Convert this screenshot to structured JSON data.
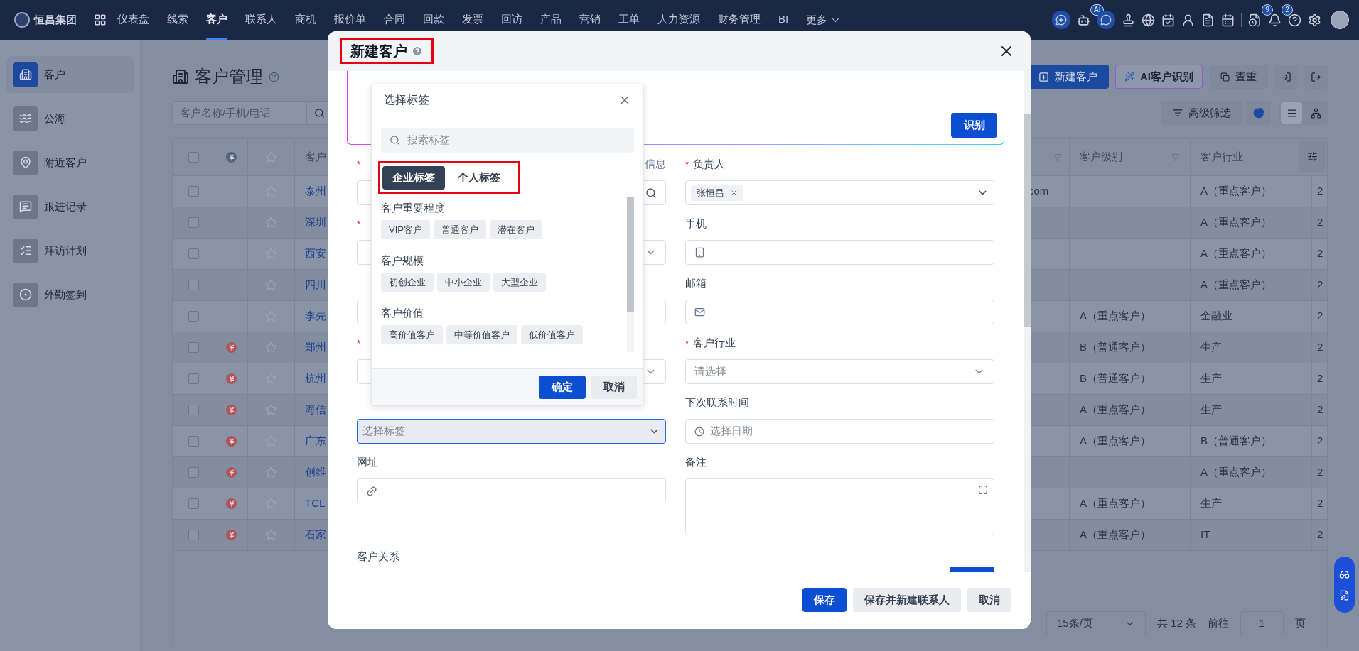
{
  "nav": {
    "logo": "恒昌集团",
    "items": [
      {
        "label": "仪表盘",
        "selected": false
      },
      {
        "label": "线索",
        "selected": false
      },
      {
        "label": "客户",
        "selected": true
      },
      {
        "label": "联系人",
        "selected": false
      },
      {
        "label": "商机",
        "selected": false
      },
      {
        "label": "报价单",
        "selected": false
      },
      {
        "label": "合同",
        "selected": false
      },
      {
        "label": "回款",
        "selected": false
      },
      {
        "label": "发票",
        "selected": false
      },
      {
        "label": "回访",
        "selected": false
      },
      {
        "label": "产品",
        "selected": false
      },
      {
        "label": "营销",
        "selected": false
      },
      {
        "label": "工单",
        "selected": false
      },
      {
        "label": "人力资源",
        "selected": false
      },
      {
        "label": "财务管理",
        "selected": false
      },
      {
        "label": "BI",
        "selected": false
      }
    ],
    "more": "更多",
    "ai_badge": "AI",
    "task_badge": "9",
    "bell_badge": "2"
  },
  "sidebar": {
    "items": [
      {
        "label": "客户",
        "kind": "building",
        "selected": true
      },
      {
        "label": "公海",
        "kind": "waves",
        "selected": false
      },
      {
        "label": "附近客户",
        "kind": "pin",
        "selected": false
      },
      {
        "label": "跟进记录",
        "kind": "chat",
        "selected": false
      },
      {
        "label": "拜访计划",
        "kind": "plan",
        "selected": false
      },
      {
        "label": "外勤签到",
        "kind": "target",
        "selected": false
      }
    ]
  },
  "page": {
    "title": "客户管理",
    "search_placeholder": "客户名称/手机/电话",
    "buttons": {
      "new": "新建客户",
      "ai": "AI客户识别",
      "dedupe": "查重",
      "filter": "高级筛选"
    },
    "views": [
      {
        "kind": "list",
        "selected": true
      },
      {
        "kind": "tree",
        "selected": false
      }
    ]
  },
  "table": {
    "header_checked": false,
    "columns": {
      "name": "客户",
      "level": "客户级别",
      "industry": "客户行业"
    },
    "rows": [
      {
        "checked": false,
        "yen": false,
        "name": "泰州",
        "column_5": "com",
        "industry": "A（重点客户）",
        "column_8": "2"
      },
      {
        "checked": false,
        "yen": false,
        "name": "深圳",
        "industry": "A（重点客户）",
        "column_8": "2"
      },
      {
        "checked": false,
        "yen": false,
        "name": "西安",
        "industry": "A（重点客户）",
        "column_8": "2"
      },
      {
        "checked": false,
        "yen": false,
        "name": "四川",
        "industry": "A（重点客户）",
        "column_8": "2"
      },
      {
        "checked": false,
        "yen": false,
        "name": "李先",
        "level": "A（重点客户）",
        "industry": "金融业",
        "column_8": "2"
      },
      {
        "checked": false,
        "yen": true,
        "name": "郑州",
        "level": "B（普通客户）",
        "industry": "生产",
        "column_8": "2"
      },
      {
        "checked": false,
        "yen": true,
        "name": "杭州",
        "level": "B（普通客户）",
        "industry": "生产",
        "column_8": "2"
      },
      {
        "checked": false,
        "yen": true,
        "name": "海信",
        "level": "A（重点客户）",
        "industry": "生产",
        "column_8": "2"
      },
      {
        "checked": false,
        "yen": true,
        "name": "广东",
        "level": "A（重点客户）",
        "industry": "B（普通客户）",
        "column_8": "2"
      },
      {
        "checked": false,
        "yen": true,
        "name": "创维",
        "industry": "A（重点客户）",
        "column_8": "2"
      },
      {
        "checked": false,
        "yen": true,
        "name": "TCL",
        "level": "A（重点客户）",
        "industry": "生产",
        "column_8": "2"
      },
      {
        "checked": false,
        "yen": true,
        "name": "石家",
        "level": "A（重点客户）",
        "industry": "IT",
        "column_8": "2"
      }
    ]
  },
  "pagination": {
    "page_size": "15条/页",
    "total": "共 12 条",
    "goto": "前往",
    "page": "1",
    "page_unit": "页"
  },
  "modal": {
    "title": "新建客户",
    "highlighted": true,
    "recognize": "识别",
    "left_fields": [
      {
        "kind": "search_input",
        "mark": "*",
        "side_link": "信息"
      },
      {
        "kind": "select",
        "mark": "*"
      },
      {
        "kind": "input"
      },
      {
        "kind": "select",
        "mark": "*"
      },
      {
        "kind": "tag_select",
        "placeholder": "选择标签",
        "focused": true
      },
      {
        "kind": "link_input",
        "label": "网址"
      }
    ],
    "right_fields": [
      {
        "kind": "tag_select",
        "mark": "*",
        "label": "负责人",
        "tags": [
          "张恒昌"
        ]
      },
      {
        "kind": "phone_input",
        "label": "手机"
      },
      {
        "kind": "email_input",
        "label": "邮箱"
      },
      {
        "kind": "select",
        "mark": "*",
        "label": "客户行业",
        "placeholder": "请选择"
      },
      {
        "kind": "date_input",
        "label": "下次联系时间",
        "placeholder": "选择日期"
      },
      {
        "kind": "textarea",
        "label": "备注"
      }
    ],
    "relation_label": "客户关系",
    "footer": [
      {
        "label": "保存",
        "kind": "primary"
      },
      {
        "label": "保存并新建联系人",
        "kind": "secondary"
      },
      {
        "label": "取消",
        "kind": "secondary"
      }
    ]
  },
  "tag_popover": {
    "title": "选择标签",
    "search_placeholder": "搜索标签",
    "highlighted": true,
    "tabs": [
      {
        "label": "企业标签",
        "selected": true
      },
      {
        "label": "个人标签",
        "selected": false
      }
    ],
    "groups": [
      {
        "title": "客户重要程度",
        "tags": [
          "VIP客户",
          "普通客户",
          "潜在客户"
        ]
      },
      {
        "title": "客户规模",
        "tags": [
          "初创企业",
          "中小企业",
          "大型企业"
        ]
      },
      {
        "title": "客户价值",
        "tags": [
          "高价值客户",
          "中等价值客户",
          "低价值客户"
        ]
      }
    ],
    "confirm": "确定",
    "cancel": "取消"
  }
}
